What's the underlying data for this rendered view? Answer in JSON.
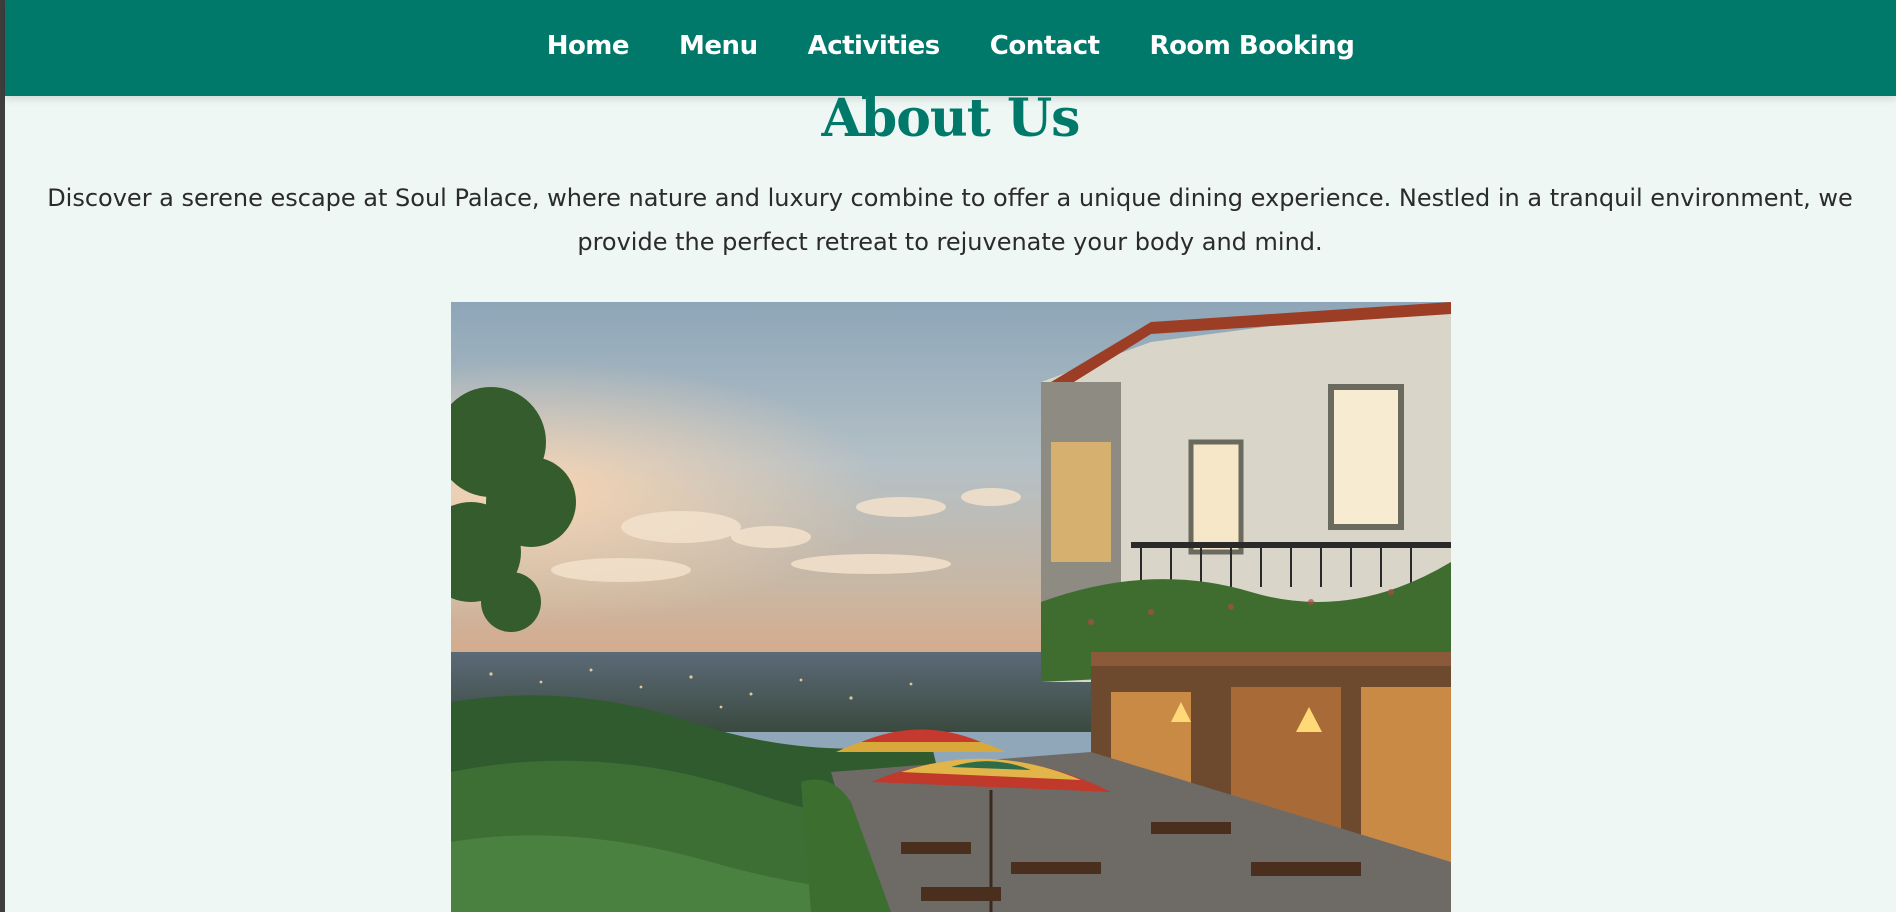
{
  "nav": {
    "items": [
      "Home",
      "Menu",
      "Activities",
      "Contact",
      "Room Booking"
    ]
  },
  "about": {
    "title": "About Us",
    "text": "Discover a serene escape at Soul Palace, where nature and luxury combine to offer a unique dining experience. Nestled in a tranquil environment, we provide the perfect retreat to rejuvenate your body and mind."
  },
  "colors": {
    "nav_bg": "#00796b",
    "title": "#00796b",
    "page_bg": "#eef7f4"
  }
}
